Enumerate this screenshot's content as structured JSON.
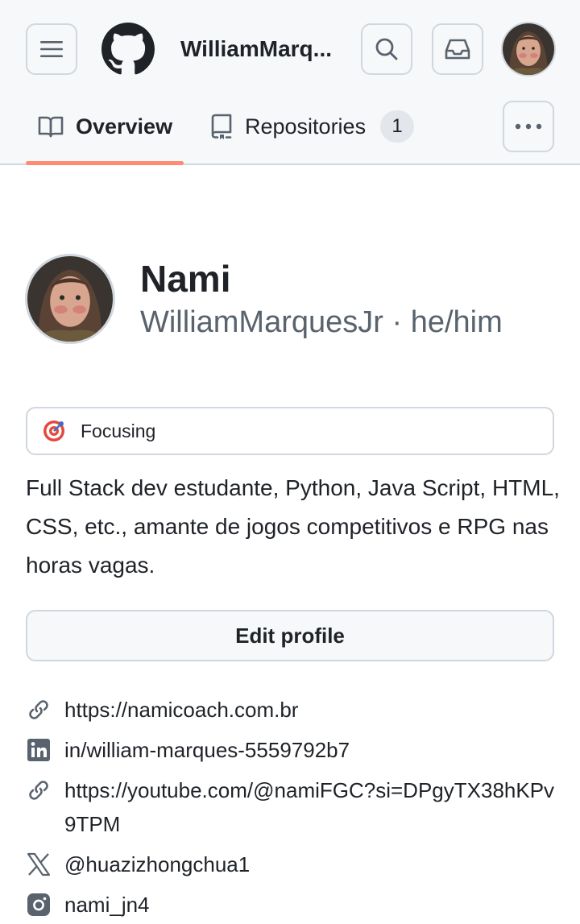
{
  "header": {
    "title": "WilliamMarq...",
    "menu_icon": "hamburger-menu-icon",
    "search_icon": "search-icon",
    "inbox_icon": "inbox-icon",
    "more_icon": "kebab-horizontal-icon"
  },
  "tabs": [
    {
      "label": "Overview",
      "icon": "book-icon",
      "selected": true
    },
    {
      "label": "Repositories",
      "icon": "repo-icon",
      "count": "1"
    }
  ],
  "profile": {
    "name": "Nami",
    "login_line": "WilliamMarquesJr · he/him",
    "status": {
      "emoji": "target-emoji",
      "text": "Focusing"
    },
    "bio": "Full Stack dev estudante, Python, Java Script, HTML, CSS, etc., amante de jogos competitivos e RPG nas horas vagas.",
    "edit_label": "Edit profile"
  },
  "links": [
    {
      "icon": "link-icon",
      "text": "https://namicoach.com.br"
    },
    {
      "icon": "linkedin-icon",
      "text": "in/william-marques-5559792b7"
    },
    {
      "icon": "link-icon",
      "text": "https://youtube.com/@namiFGC?si=DPgyTX38hKPv9TPM"
    },
    {
      "icon": "x-twitter-icon",
      "text": "@huazizhongchua1"
    },
    {
      "icon": "instagram-icon",
      "text": "nami_jn4"
    }
  ],
  "colors": {
    "accent_underline": "#fd8c73",
    "header_bg": "#f6f8fa",
    "border": "#d0d7de",
    "muted_text": "#59636e"
  }
}
